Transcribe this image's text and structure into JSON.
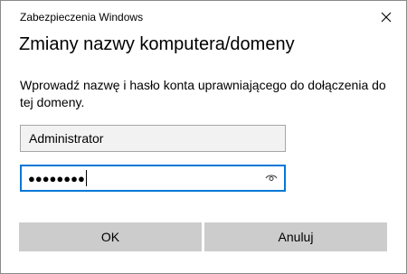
{
  "window": {
    "title": "Zabezpieczenia Windows",
    "close_icon": "close-icon"
  },
  "dialog": {
    "heading": "Zmiany nazwy komputera/domeny",
    "message": "Wprowadź nazwę i hasło konta uprawniającego do dołączenia do tej domeny."
  },
  "form": {
    "username_value": "Administrator",
    "password_masked": "●●●●●●●●",
    "reveal_icon": "eye-icon"
  },
  "buttons": {
    "ok_label": "OK",
    "cancel_label": "Anuluj"
  },
  "colors": {
    "focus_border": "#0078d7",
    "button_bg": "#cccccc",
    "field_bg": "#f2f2f2"
  }
}
